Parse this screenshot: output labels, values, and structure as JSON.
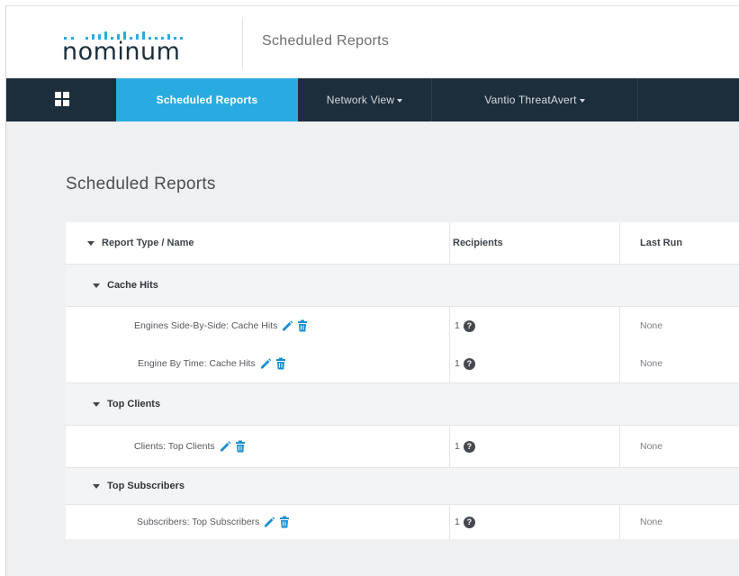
{
  "header": {
    "logo_text": "nominum",
    "title": "Scheduled Reports"
  },
  "nav": {
    "apps_icon": "grid-icon",
    "items": [
      {
        "label": "Scheduled Reports",
        "active": true
      },
      {
        "label": "Network View",
        "has_dropdown": true
      },
      {
        "label": "Vantio ThreatAvert",
        "has_dropdown": true
      }
    ]
  },
  "page": {
    "title": "Scheduled Reports"
  },
  "table": {
    "columns": [
      "Report Type / Name",
      "Recipients",
      "Last Run"
    ],
    "groups": [
      {
        "name": "Cache Hits",
        "reports": [
          {
            "name": "Engines Side-By-Side: Cache Hits",
            "recipients": "1",
            "last_run": "None"
          },
          {
            "name": "Engine By Time: Cache Hits",
            "recipients": "1",
            "last_run": "None"
          }
        ]
      },
      {
        "name": "Top Clients",
        "reports": [
          {
            "name": "Clients: Top Clients",
            "recipients": "1",
            "last_run": "None"
          }
        ]
      },
      {
        "name": "Top Subscribers",
        "reports": [
          {
            "name": "Subscribers: Top Subscribers",
            "recipients": "1",
            "last_run": "None"
          }
        ]
      }
    ],
    "help_glyph": "?"
  },
  "colors": {
    "nav_bg": "#1c2d3b",
    "accent": "#29abe2",
    "page_bg": "#eef0f1",
    "group_row_bg": "#f3f4f5"
  },
  "icons": {
    "edit": "pencil-icon",
    "delete": "trash-icon",
    "help": "help-circle-icon",
    "expand": "triangle-down-icon"
  }
}
